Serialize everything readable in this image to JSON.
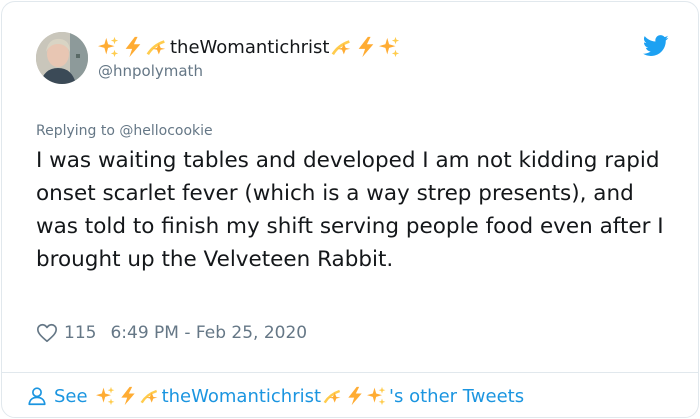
{
  "author": {
    "display_name": "theWomantichrist",
    "handle": "@hnpolymath",
    "name_emoji_before": [
      "sparkles",
      "high-voltage",
      "dizzy"
    ],
    "name_emoji_after": [
      "dizzy",
      "high-voltage",
      "sparkles"
    ]
  },
  "reply": {
    "prefix": "Replying to",
    "mention": "@hellocookie"
  },
  "tweet": {
    "text": "I was waiting tables and developed I am not kidding rapid onset scarlet fever (which is a way strep presents), and was told to finish my shift serving people food even after I brought up the Velveteen Rabbit."
  },
  "meta": {
    "likes": "115",
    "timestamp": "6:49 PM - Feb 25, 2020"
  },
  "footer": {
    "see_label": "See",
    "name": "theWomantichrist",
    "suffix": "'s other Tweets"
  },
  "colors": {
    "link_blue": "#1b95e0",
    "twitter_blue": "#1da1f2",
    "muted_gray": "#657786",
    "text": "#14171a",
    "border": "#e1e8ed"
  },
  "icons": [
    "avatar",
    "twitter-bird-icon",
    "heart-icon",
    "person-icon",
    "sparkles-icon",
    "high-voltage-icon",
    "dizzy-icon"
  ]
}
